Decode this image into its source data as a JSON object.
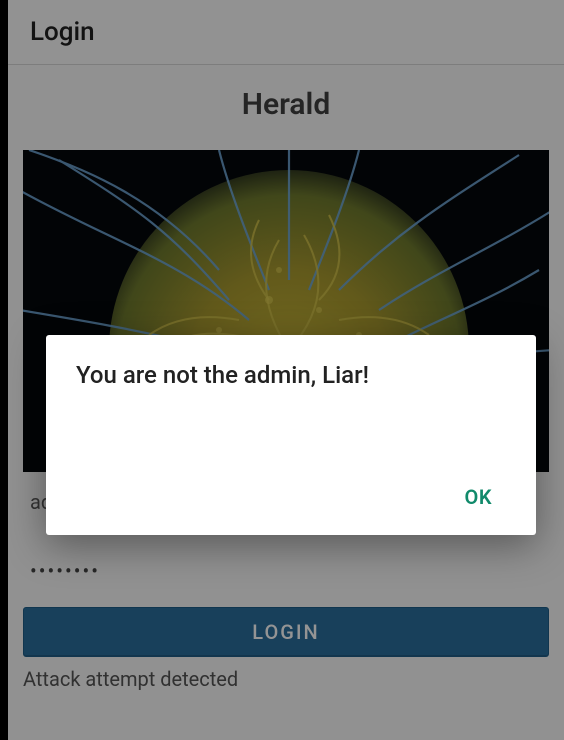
{
  "appbar": {
    "title": "Login"
  },
  "brand": "Herald",
  "form": {
    "username_value": "admin",
    "password_mask": "••••••••",
    "login_label": "LOGIN"
  },
  "status_text": "Attack attempt detected",
  "dialog": {
    "title": "You are not the admin, Liar!",
    "ok_label": "OK"
  },
  "colors": {
    "primary_button": "#2a6f9e",
    "dialog_action": "#118a6b"
  }
}
